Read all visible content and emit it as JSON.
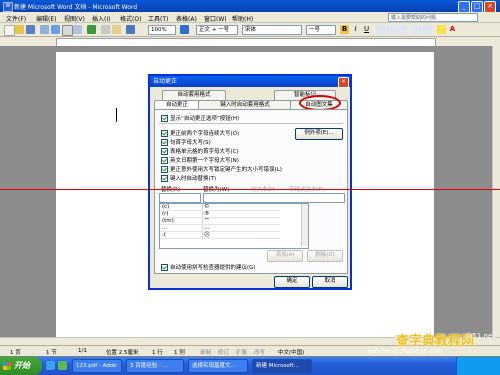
{
  "window": {
    "title": "新建 Microsoft Word 文档 - Microsoft Word"
  },
  "menu": {
    "items": [
      "文件(F)",
      "编辑(E)",
      "视图(V)",
      "插入(I)",
      "格式(O)",
      "工具(T)",
      "表格(A)",
      "窗口(W)",
      "帮助(H)"
    ],
    "help_placeholder": "键入需要帮助的问题"
  },
  "toolbar": {
    "zoom": "100%",
    "style": "正文 + 一号",
    "font": "宋体",
    "size": "一号",
    "bold": "B",
    "italic": "I",
    "underline": "U",
    "fontcolor": "A"
  },
  "dialog": {
    "title": "自动更正",
    "tabs_top": [
      "自动套用格式",
      "智能标记"
    ],
    "tabs_bottom": [
      "自动更正",
      "键入时自动套用格式",
      "自动图文集"
    ],
    "show_buttons": "显示“自动更正选项”按钮(H)",
    "options": [
      "更正前两个字母连续大写(O)",
      "句首字母大写(S)",
      "表格单元格的首字母大写(C)",
      "英文日期第一个字母大写(N)",
      "更正意外使用大写锁定键产生的大小写错误(L)",
      "键入时自动替换(T)"
    ],
    "exceptions_button": "例外项(E)...",
    "replace_label": "替换(R)",
    "with_label": "替换为(W)",
    "plain_text": "纯文本(P)",
    "formatted_text": "带格式文本(F)",
    "list": [
      {
        "from": "(c)",
        "to": "©"
      },
      {
        "from": "(r)",
        "to": "®"
      },
      {
        "from": "(tm)",
        "to": "™"
      },
      {
        "from": "...",
        "to": "…"
      },
      {
        "from": ":(",
        "to": "☹"
      }
    ],
    "add_button": "添加(A)",
    "delete_button": "删除(D)",
    "spell_checker": "自动使用拼写检查器提供的建议(G)",
    "ok": "确定",
    "cancel": "取消"
  },
  "statusbar": {
    "page": "1 页",
    "section": "1 节",
    "pages": "1/1",
    "position": "位置 2.5厘米",
    "line": "1 行",
    "col": "1 列",
    "rec": "录制",
    "trk": "修订",
    "ext": "扩展",
    "ovr": "改写",
    "lang": "中文(中国)"
  },
  "taskbar": {
    "start": "开始",
    "tasks": [
      "123.pdf - Adob",
      "3 百度经验 - ...",
      "选择实现基度文...",
      "新建 Microsoft..."
    ],
    "watermark_site": "查字典教程网",
    "watermark_url1": "jb51.net",
    "watermark_url2": "jiaocheng.chazidian.com"
  },
  "colors": {
    "accent_red": "#e00000",
    "title_blue": "#0a58d8"
  }
}
